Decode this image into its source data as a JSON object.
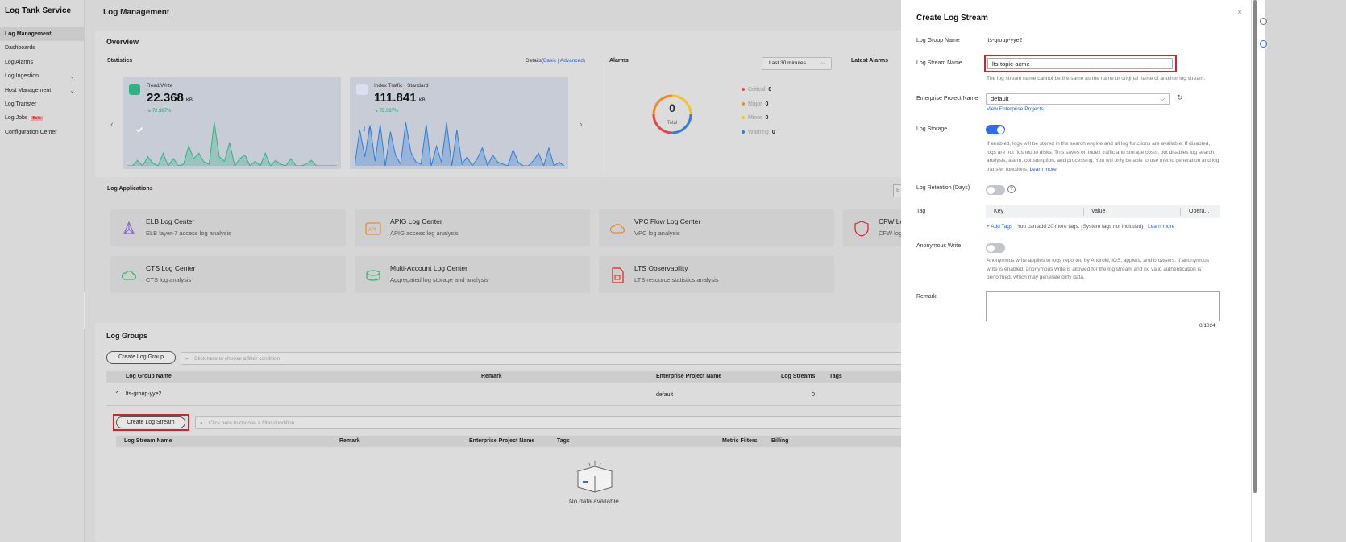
{
  "sidebar": {
    "brand": "Log Tank Service",
    "items": [
      {
        "label": "Log Management",
        "active": true,
        "chevron": false,
        "beta": ""
      },
      {
        "label": "Dashboards",
        "active": false,
        "chevron": false,
        "beta": ""
      },
      {
        "label": "Log Alarms",
        "active": false,
        "chevron": false,
        "beta": ""
      },
      {
        "label": "Log Ingestion",
        "active": false,
        "chevron": true,
        "beta": ""
      },
      {
        "label": "Host Management",
        "active": false,
        "chevron": true,
        "beta": ""
      },
      {
        "label": "Log Transfer",
        "active": false,
        "chevron": false,
        "beta": ""
      },
      {
        "label": "Log Jobs",
        "active": false,
        "chevron": false,
        "beta": "Beta"
      },
      {
        "label": "Configuration Center",
        "active": false,
        "chevron": false,
        "beta": ""
      }
    ]
  },
  "main": {
    "title": "Log Management",
    "overview": {
      "title": "Overview",
      "statistics_label": "Statistics",
      "details_prefix": "Details(",
      "details_basic": "Basic",
      "details_sep": " | ",
      "details_advanced": "Advanced",
      "details_suffix": ")",
      "stats": [
        {
          "label": "Read/Write",
          "value": "22.368",
          "unit": "KB",
          "trend": "72.387%",
          "color": "#2fb383",
          "series": [
            0,
            0,
            6,
            0,
            10,
            3,
            0,
            14,
            0,
            8,
            0,
            2,
            22,
            8,
            14,
            4,
            2,
            48,
            10,
            5,
            26,
            0,
            8,
            12,
            0,
            5,
            0,
            14,
            0,
            6,
            2,
            0,
            8,
            0,
            0,
            2,
            6,
            0,
            0,
            0,
            0,
            0
          ]
        },
        {
          "label": "Index Traffic - Standard",
          "value": "111.841",
          "unit": "KB",
          "trend": "72.387%",
          "color": "#2f7fd8",
          "series": [
            0,
            40,
            10,
            45,
            5,
            46,
            0,
            38,
            12,
            2,
            48,
            15,
            4,
            2,
            46,
            0,
            22,
            4,
            48,
            0,
            40,
            2,
            10,
            0,
            8,
            20,
            0,
            12,
            4,
            2,
            0,
            18,
            4,
            0,
            0,
            6,
            14,
            0,
            20,
            0,
            4,
            0
          ]
        }
      ],
      "alarms_label": "Alarms",
      "time_select": "Last 30 minutes",
      "total_value": "0",
      "total_label": "Total",
      "alarm_rows": [
        {
          "label": "Critical",
          "count": "0",
          "color": "#e0464b"
        },
        {
          "label": "Major",
          "count": "0",
          "color": "#ee8a2c"
        },
        {
          "label": "Minor",
          "count": "0",
          "color": "#f2c230"
        },
        {
          "label": "Warning",
          "count": "0",
          "color": "#2f7fd8"
        }
      ],
      "latest_alarms_label": "Latest Alarms"
    },
    "log_applications": {
      "title": "Log Applications",
      "search_stub": "E",
      "apps": [
        {
          "name": "ELB Log Center",
          "desc": "ELB layer-7 access log analysis",
          "icon": "elb-icon"
        },
        {
          "name": "APIG Log Center",
          "desc": "APIG access log analysis",
          "icon": "apig-icon"
        },
        {
          "name": "VPC Flow Log Center",
          "desc": "VPC log analysis",
          "icon": "vpc-icon"
        },
        {
          "name": "CFW Lo",
          "desc": "CFW log",
          "icon": "cfw-icon"
        },
        {
          "name": "CTS Log Center",
          "desc": "CTS log analysis",
          "icon": "cts-icon"
        },
        {
          "name": "Multi-Account Log Center",
          "desc": "Aggregated log storage and analysis",
          "icon": "multi-account-icon"
        },
        {
          "name": "LTS Observability",
          "desc": "LTS resource statistics analysis",
          "icon": "lts-icon"
        }
      ]
    },
    "log_groups": {
      "title": "Log Groups",
      "create_button": "Create Log Group",
      "filter_placeholder": "Click here to choose a filter condition",
      "columns": [
        "Log Group Name",
        "Remark",
        "Enterprise Project Name",
        "Log Streams",
        "Tags"
      ],
      "row": {
        "name": "lts-group-yye2",
        "remark": "",
        "enterprise_project": "default",
        "log_streams": "0"
      },
      "create_stream_button": "Create Log Stream",
      "stream_filter_placeholder": "Click here to choose a filter condition",
      "stream_columns": [
        "Log Stream Name",
        "Remark",
        "Enterprise Project Name",
        "Tags",
        "Metric Filters",
        "Billing"
      ],
      "empty_text": "No data available."
    }
  },
  "panel": {
    "title": "Create Log Stream",
    "log_group_label": "Log Group Name",
    "log_group_value": "lts-group-yye2",
    "log_stream_label": "Log Stream Name",
    "log_stream_value": "lts-topic-acme",
    "log_stream_help": "The log stream name cannot be the same as the name or original name of another log stream.",
    "enterprise_label": "Enterprise Project Name",
    "enterprise_value": "default",
    "view_enterprise_link": "View Enterprise Projects",
    "log_storage_label": "Log Storage",
    "log_storage_on": true,
    "log_storage_help_lines": [
      "If enabled, logs will be stored in the search engine and all log functions are available. If disabled,",
      "logs are not flushed to disks. This saves on index traffic and storage costs, but disables log search,",
      "analysis, alarm, consumption, and processing. You will only be able to use metric generation and log"
    ],
    "log_storage_help_last": "transfer functions.",
    "learn_more": "Learn more",
    "retention_label": "Log Retention (Days)",
    "retention_on": false,
    "tag_label": "Tag",
    "tag_columns": [
      "Key",
      "Value",
      "Opera..."
    ],
    "add_tags": "+ Add Tags",
    "tags_note": "You can add 20 more tags. (System tags not included)",
    "anonymous_label": "Anonymous Write",
    "anonymous_on": false,
    "anonymous_help_lines": [
      "Anonymous write applies to logs reported by Android, iOS, applets, and browsers. If anonymous",
      "write is enabled, anonymous write is allowed for the log stream and no valid authentication is",
      "performed, which may generate dirty data."
    ],
    "remark_label": "Remark",
    "remark_value": "",
    "remark_count": "0/1024"
  },
  "colors": {
    "accent": "#2b5fc7",
    "toggle_on": "#2f6ee8",
    "toggle_off": "#c4c6cc",
    "highlight": "#d9202a"
  }
}
